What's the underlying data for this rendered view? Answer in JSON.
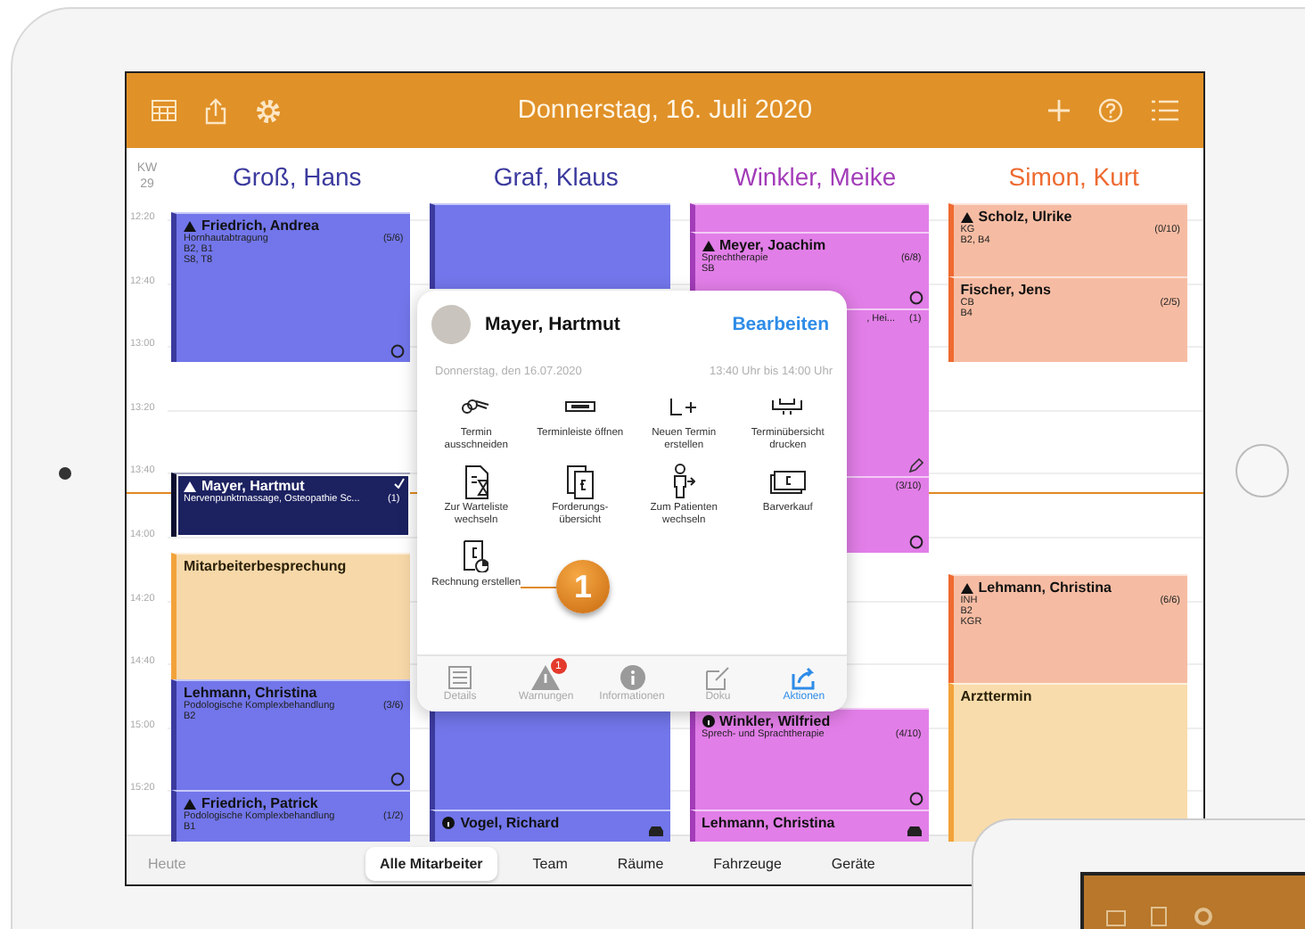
{
  "toolbar": {
    "title": "Donnerstag, 16. Juli 2020"
  },
  "week": {
    "label": "KW",
    "number": "29"
  },
  "time_labels": [
    "12:20",
    "12:40",
    "13:00",
    "13:20",
    "13:40",
    "14:00",
    "14:20",
    "14:40",
    "15:00",
    "15:20"
  ],
  "columns": [
    {
      "name": "Groß, Hans",
      "color": "#3b3a9e",
      "appointments": [
        {
          "kind": "treatment",
          "color": "#7276ea",
          "selected": false,
          "warning": true,
          "open": true,
          "name": "Friedrich, Andrea",
          "detail": "Hornhautabtragung",
          "count": "(5/6)",
          "lines": [
            "B2, B1",
            "S8, T8"
          ]
        },
        {
          "kind": "treatment",
          "color": "#1c2160",
          "selected": true,
          "warning": true,
          "confirmed": true,
          "name": "Mayer, Hartmut",
          "detail": "Nervenpunktmassage, Osteopathie Sc...",
          "count": "(1)"
        },
        {
          "kind": "meeting",
          "color": "#f7d8a8",
          "selected": false,
          "name": "Mitarbeiterbesprechung"
        },
        {
          "kind": "treatment",
          "color": "#7276ea",
          "selected": false,
          "open": true,
          "name": "Lehmann, Christina",
          "detail": "Podologische Komplexbehandlung",
          "count": "(3/6)",
          "lines": [
            "B2"
          ]
        },
        {
          "kind": "treatment",
          "color": "#7276ea",
          "selected": false,
          "warning": true,
          "name": "Friedrich, Patrick",
          "detail": "Podologische Komplexbehandlung",
          "count": "(1/2)",
          "lines": [
            "B1"
          ]
        }
      ]
    },
    {
      "name": "Graf, Klaus",
      "color": "#3b3a9e",
      "appointments": [
        {
          "kind": "treatment",
          "color": "#7276ea",
          "selected": false
        },
        {
          "kind": "treatment",
          "color": "#7276ea",
          "selected": false
        },
        {
          "kind": "treatment",
          "color": "#7276ea",
          "selected": false,
          "info": true,
          "vehicle": true,
          "name": "Vogel, Richard"
        }
      ]
    },
    {
      "name": "Winkler, Meike",
      "color": "#a23cb8",
      "appointments": [
        {
          "kind": "treatment",
          "color": "#e27ee8",
          "selected": false
        },
        {
          "kind": "treatment",
          "color": "#e27ee8",
          "selected": false,
          "warning": true,
          "open": true,
          "name": "Meyer, Joachim",
          "detail": "Sprechtherapie",
          "count": "(6/8)",
          "lines": [
            "SB"
          ]
        },
        {
          "kind": "treatment",
          "color": "#e27ee8",
          "selected": false,
          "note": true,
          "detail": ", Hei...",
          "count": "(1)"
        },
        {
          "kind": "treatment",
          "color": "#e27ee8",
          "selected": false,
          "open": true,
          "count": "(3/10)"
        },
        {
          "kind": "treatment",
          "color": "#e27ee8",
          "selected": false,
          "info": true,
          "open": true,
          "name": "Winkler, Wilfried",
          "detail": "Sprech- und Sprachtherapie",
          "count": "(4/10)"
        },
        {
          "kind": "treatment",
          "color": "#e27ee8",
          "selected": false,
          "vehicle": true,
          "name": "Lehmann, Christina"
        }
      ]
    },
    {
      "name": "Simon, Kurt",
      "color": "#ee6a30",
      "appointments": [
        {
          "kind": "treatment",
          "color": "#f6bca3",
          "selected": false,
          "warning": true,
          "name": "Scholz, Ulrike",
          "detail": "KG",
          "count": "(0/10)",
          "lines": [
            "B2, B4"
          ]
        },
        {
          "kind": "treatment",
          "color": "#f6bca3",
          "selected": false,
          "name": "Fischer, Jens",
          "detail": "CB",
          "count": "(2/5)",
          "lines": [
            "B4"
          ]
        },
        {
          "kind": "treatment",
          "color": "#f6bca3",
          "selected": false,
          "warning": true,
          "name": "Lehmann, Christina",
          "detail": "INH",
          "count": "(6/6)",
          "lines": [
            "B2",
            "KGR"
          ]
        },
        {
          "kind": "meeting",
          "color": "#f9dcab",
          "selected": false,
          "name": "Arzttermin"
        }
      ]
    }
  ],
  "popup": {
    "name": "Mayer, Hartmut",
    "edit": "Bearbeiten",
    "date": "Donnerstag, den 16.07.2020",
    "time": "13:40 Uhr bis 14:00 Uhr",
    "actions": [
      {
        "label": "Termin ausschneiden"
      },
      {
        "label": "Terminleiste öffnen"
      },
      {
        "label": "Neuen Termin erstellen"
      },
      {
        "label": "Terminübersicht drucken"
      },
      {
        "label": "Zur Warteliste wechseln"
      },
      {
        "label": "Forderungs-übersicht"
      },
      {
        "label": "Zum Patienten wechseln"
      },
      {
        "label": "Barverkauf"
      },
      {
        "label": "Rechnung erstellen"
      }
    ],
    "callout": "1",
    "tabs": [
      {
        "label": "Details",
        "selected": false
      },
      {
        "label": "Warnungen",
        "selected": false,
        "badge": "1"
      },
      {
        "label": "Informationen",
        "selected": false
      },
      {
        "label": "Doku",
        "selected": false
      },
      {
        "label": "Aktionen",
        "selected": true
      }
    ]
  },
  "bottom_bar": {
    "today": "Heute",
    "segments": [
      {
        "label": "Alle Mitarbeiter",
        "selected": true
      },
      {
        "label": "Team",
        "selected": false
      },
      {
        "label": "Räume",
        "selected": false
      },
      {
        "label": "Fahrzeuge",
        "selected": false
      },
      {
        "label": "Geräte",
        "selected": false
      }
    ]
  }
}
